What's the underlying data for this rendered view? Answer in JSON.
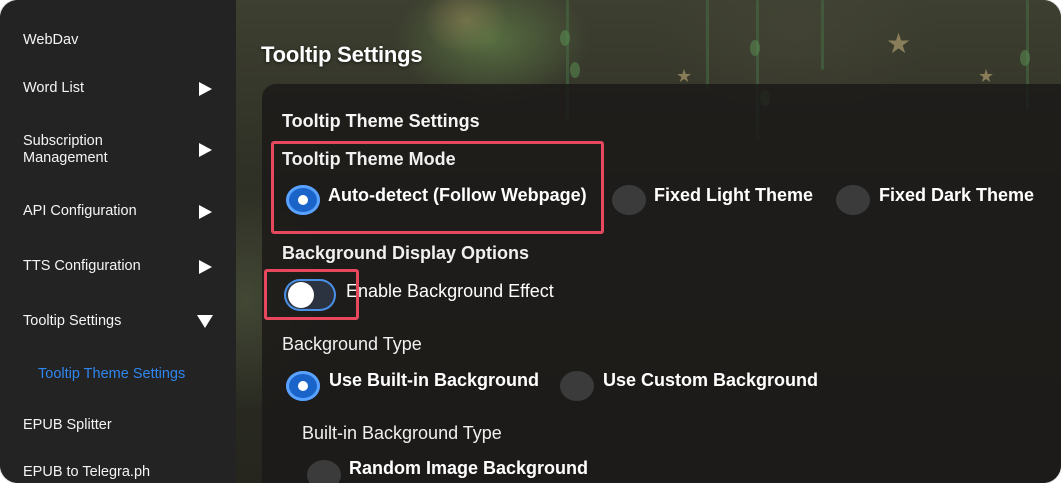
{
  "sidebar": {
    "items": [
      {
        "label": "WebDav"
      },
      {
        "label": "Word List"
      },
      {
        "label": "Subscription\nManagement"
      },
      {
        "label": "API Configuration"
      },
      {
        "label": "TTS Configuration"
      },
      {
        "label": "Tooltip Settings"
      },
      {
        "label": "EPUB Splitter"
      },
      {
        "label": "EPUB to Telegra.ph"
      }
    ],
    "sub_item": {
      "label": "Tooltip Theme Settings"
    },
    "active_color": "#2f86f0"
  },
  "main": {
    "page_title": "Tooltip Settings",
    "section_heading": "Tooltip Theme Settings",
    "theme_mode": {
      "label": "Tooltip Theme Mode",
      "options": [
        {
          "label": "Auto-detect (Follow Webpage)",
          "selected": true
        },
        {
          "label": "Fixed Light Theme",
          "selected": false
        },
        {
          "label": "Fixed Dark Theme",
          "selected": false
        }
      ]
    },
    "background_display": {
      "label": "Background Display Options",
      "toggle_label": "Enable Background Effect",
      "toggle_on": false
    },
    "background_type": {
      "label": "Background Type",
      "options": [
        {
          "label": "Use Built-in Background",
          "selected": true
        },
        {
          "label": "Use Custom Background",
          "selected": false
        }
      ]
    },
    "builtin_type": {
      "label": "Built-in Background Type",
      "options": [
        {
          "label": "Random Image Background",
          "selected": false
        }
      ]
    }
  },
  "colors": {
    "highlight": "#e8485e",
    "radio_selected": "#1a63c9",
    "sidebar_bg": "#232323"
  }
}
